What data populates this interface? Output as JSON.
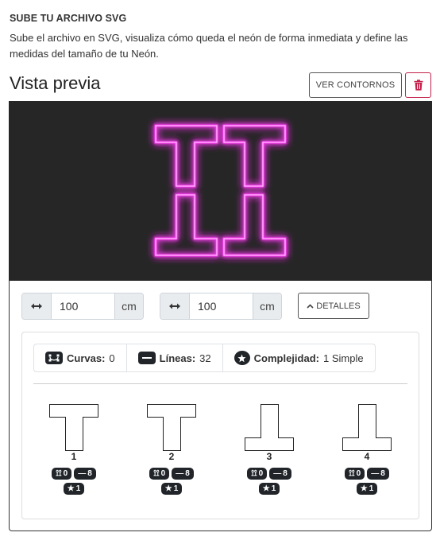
{
  "upload": {
    "title": "SUBE TU ARCHIVO SVG",
    "description": "Sube el archivo en SVG, visualiza cómo queda el neón de forma inmediata y define las medidas del tamaño de tu Neón."
  },
  "preview": {
    "heading": "Vista previa",
    "contours_button": "VER CONTORNOS",
    "neon_color": "#ff3df5",
    "canvas_bg": "#262626"
  },
  "dimensions": {
    "width": {
      "value": "100",
      "unit": "cm"
    },
    "height": {
      "value": "100",
      "unit": "cm"
    },
    "details_button": "DETALLES"
  },
  "stats": {
    "curves_label": "Curvas:",
    "curves_value": "0",
    "lines_label": "Líneas:",
    "lines_value": "32",
    "complexity_label": "Complejidad:",
    "complexity_value": "1 Simple"
  },
  "pieces": [
    {
      "number": "1",
      "curves": "0",
      "lines": "8",
      "complexity": "1"
    },
    {
      "number": "2",
      "curves": "0",
      "lines": "8",
      "complexity": "1"
    },
    {
      "number": "3",
      "curves": "0",
      "lines": "8",
      "complexity": "1"
    },
    {
      "number": "4",
      "curves": "0",
      "lines": "8",
      "complexity": "1"
    }
  ],
  "colors": {
    "delete_accent": "#c4204a",
    "badge_bg": "#212529"
  }
}
